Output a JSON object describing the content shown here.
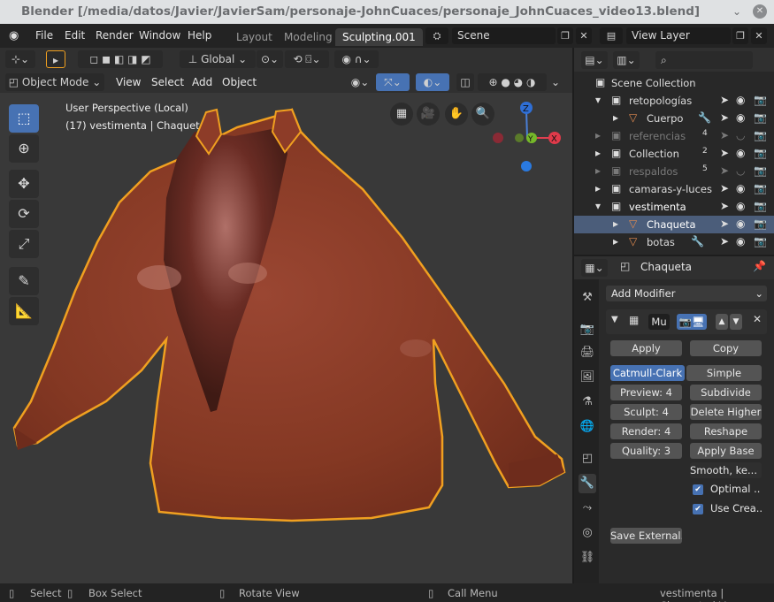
{
  "window": {
    "title": "Blender [/media/datos/Javier/JavierSam/personaje-JohnCuaces/personaje_JohnCuaces_video13.blend]",
    "minimize_icon": "chevron-down-icon",
    "close_icon": "close-icon"
  },
  "topbar": {
    "menus": [
      "File",
      "Edit",
      "Render",
      "Window",
      "Help"
    ],
    "workspaces": [
      "Layout",
      "Modeling",
      "Sculpting.001"
    ],
    "active_workspace": "Sculpting.001",
    "scene_label": "Scene",
    "view_layer_label": "View Layer"
  },
  "viewport": {
    "transform_orientation": "Global",
    "mode": "Object Mode",
    "menus": [
      "View",
      "Select",
      "Add",
      "Object"
    ],
    "perspective_label": "User Perspective (Local)",
    "object_label": "(17) vestimenta | Chaqueta",
    "gizmo_axes": {
      "x": "X",
      "y": "Y",
      "z": "Z"
    },
    "colors": {
      "background": "#393939",
      "jacket": "#8a3a26",
      "outline": "#f0a020"
    }
  },
  "outliner": {
    "root": "Scene Collection",
    "rows": [
      {
        "label": "retopologías",
        "type": "collection",
        "state": "normal"
      },
      {
        "label": "Cuerpo",
        "type": "mesh",
        "state": "normal"
      },
      {
        "label": "referencias",
        "type": "collection",
        "state": "dim",
        "badge": "4"
      },
      {
        "label": "Collection",
        "type": "collection",
        "state": "normal",
        "badge": "2"
      },
      {
        "label": "respaldos",
        "type": "collection",
        "state": "dim",
        "badge": "5"
      },
      {
        "label": "camaras-y-luces",
        "type": "collection",
        "state": "normal"
      },
      {
        "label": "vestimenta",
        "type": "collection",
        "state": "normal"
      },
      {
        "label": "Chaqueta",
        "type": "mesh",
        "state": "selected"
      },
      {
        "label": "botas",
        "type": "mesh",
        "state": "normal"
      }
    ]
  },
  "properties": {
    "object_name": "Chaqueta",
    "add_modifier_label": "Add Modifier",
    "modifier_name": "Mu",
    "apply_label": "Apply",
    "copy_label": "Copy",
    "subdiv_types": [
      "Catmull-Clark",
      "Simple"
    ],
    "active_subdiv_type": "Catmull-Clark",
    "fields": [
      {
        "label": "Preview:",
        "value": "4"
      },
      {
        "label": "Sculpt:",
        "value": "4"
      },
      {
        "label": "Render:",
        "value": "4"
      },
      {
        "label": "Quality:",
        "value": "3"
      }
    ],
    "right_buttons": [
      "Subdivide",
      "Delete Higher",
      "Reshape",
      "Apply Base"
    ],
    "smooth_dropdown": "Smooth, ke...",
    "checkboxes": [
      {
        "label": "Optimal ..",
        "checked": true
      },
      {
        "label": "Use Crea..",
        "checked": true
      }
    ],
    "save_external_label": "Save External..."
  },
  "statusbar": {
    "select": "Select",
    "box_select": "Box Select",
    "rotate_view": "Rotate View",
    "call_menu": "Call Menu",
    "info": "vestimenta | Chaqueta | V"
  }
}
